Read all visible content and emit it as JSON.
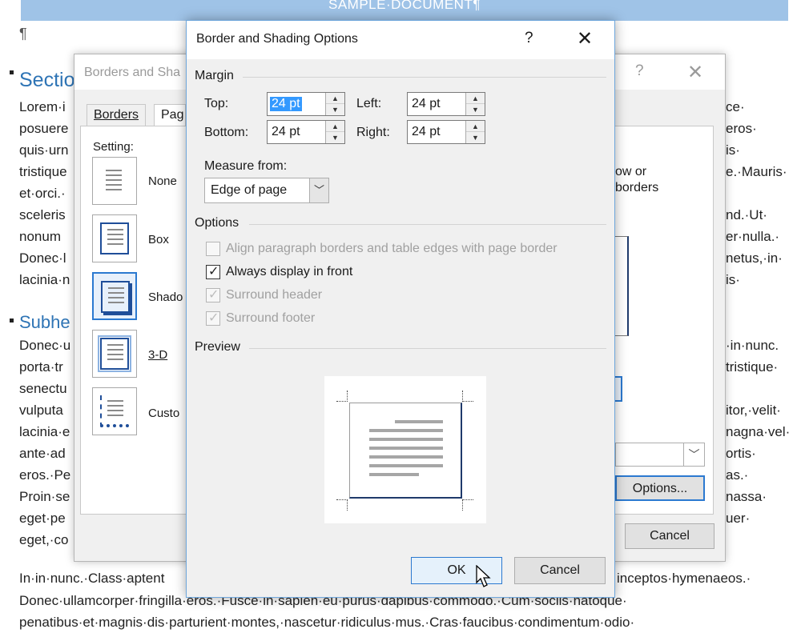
{
  "document": {
    "header": "SAMPLE·DOCUMENT¶",
    "pilcrow": "¶",
    "heading1": "Sectio",
    "heading2": "Subhe",
    "left_lines_1": [
      "Lorem·i",
      "posuere",
      "quis·urn",
      "tristique",
      "et·orci.·",
      "sceleris",
      "nonum",
      "Donec·l",
      "lacinia·n"
    ],
    "right_lines_1": [
      "ce·",
      "eros·",
      "is·",
      "e.·Mauris·",
      "nd.·Ut·",
      "er·nulla.·",
      "netus,·in·",
      "is·"
    ],
    "left_lines_2": [
      "Donec·u",
      "porta·tr",
      "senectu",
      "vulputa",
      "lacinia·e",
      "ante·ad",
      "eros.·Pe",
      "Proin·se",
      "eget·pe",
      "eget,·co"
    ],
    "right_lines_2": [
      "·in·nunc.",
      "tristique·",
      "",
      "itor,·velit·",
      "nagna·vel·",
      "ortis·",
      "as.·",
      "nassa·",
      "uer·",
      ""
    ],
    "bottom_line_1": "In·in·nunc.·Class·aptent",
    "bottom_line_1_right": "inceptos·hymenaeos.·",
    "bottom_line_2": "Donec·ullamcorper·fringilla·eros.·Fusce·in·sapien·eu·purus·dapibus·commodo.·Cum·sociis·natoque·",
    "bottom_line_3": "penatibus·et·magnis·dis·parturient·montes,·nascetur·ridiculus·mus.·Cras·faucibus·condimentum·odio·"
  },
  "back_dialog": {
    "title": "Borders and Sha",
    "help": "?",
    "close": "✕",
    "tabs": [
      "Borders",
      "Pag"
    ],
    "setting_label": "Setting:",
    "settings": [
      "None",
      "Box",
      "Shado",
      "3-D",
      "Custo"
    ],
    "partial_text_1": "ow or",
    "partial_text_2": "borders",
    "options_button": "Options...",
    "cancel_button": "Cancel"
  },
  "dialog": {
    "title": "Border and Shading Options",
    "help": "?",
    "close": "✕",
    "margin_label": "Margin",
    "top_label": "Top:",
    "top_value": "24 pt",
    "left_label": "Left:",
    "left_value": "24 pt",
    "bottom_label": "Bottom:",
    "bottom_value": "24 pt",
    "right_label": "Right:",
    "right_value": "24 pt",
    "measure_label": "Measure from:",
    "measure_value": "Edge of page",
    "options_label": "Options",
    "checks": [
      {
        "label": "Align paragraph borders and table edges with page border",
        "checked": false,
        "disabled": true
      },
      {
        "label": "Always display in front",
        "checked": true,
        "disabled": false
      },
      {
        "label": "Surround header",
        "checked": true,
        "disabled": true
      },
      {
        "label": "Surround footer",
        "checked": true,
        "disabled": true
      }
    ],
    "preview_label": "Preview",
    "ok_button": "OK",
    "cancel_button": "Cancel"
  }
}
